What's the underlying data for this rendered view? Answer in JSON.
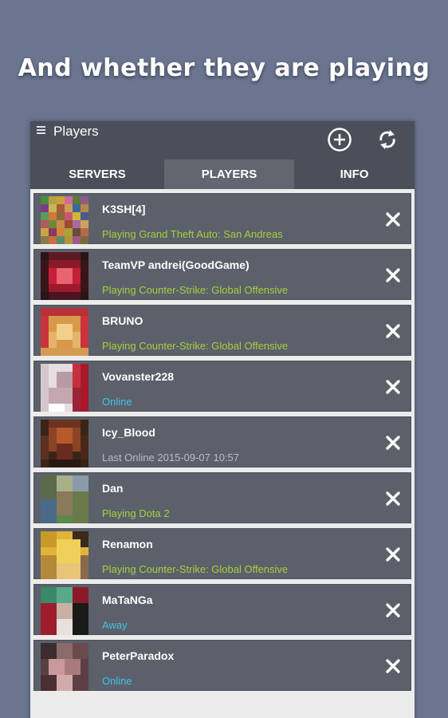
{
  "headline": "And whether they are playing",
  "appbar": {
    "title": "Players",
    "add_icon": "add-circle-icon",
    "refresh_icon": "refresh-icon"
  },
  "tabs": [
    {
      "label": "SERVERS",
      "active": false
    },
    {
      "label": "PLAYERS",
      "active": true
    },
    {
      "label": "INFO",
      "active": false
    }
  ],
  "colors": {
    "background": "#6a7590",
    "appbar": "#4a4f59",
    "row": "#5c606a",
    "playing": "#a5cf3c",
    "online": "#40c4ea",
    "offline": "#b8bcc4"
  },
  "players": [
    {
      "name": "K3SH[4]",
      "status": "Playing Grand Theft Auto: San Andreas",
      "state": "playing"
    },
    {
      "name": "TeamVP andrei(GoodGame)",
      "status": "Playing Counter-Strike: Global Offensive",
      "state": "playing"
    },
    {
      "name": "BRUNO",
      "status": "Playing Counter-Strike: Global Offensive",
      "state": "playing"
    },
    {
      "name": "Vovanster228",
      "status": "Online",
      "state": "online"
    },
    {
      "name": "Icy_Blood",
      "status": "Last Online 2015-09-07 10:57",
      "state": "offline"
    },
    {
      "name": "Dan",
      "status": "Playing Dota 2",
      "state": "playing"
    },
    {
      "name": "Renamon",
      "status": "Playing Counter-Strike: Global Offensive",
      "state": "playing"
    },
    {
      "name": "MaTaNGa",
      "status": "Away",
      "state": "away"
    },
    {
      "name": "PeterParadox",
      "status": "Online",
      "state": "online"
    }
  ]
}
